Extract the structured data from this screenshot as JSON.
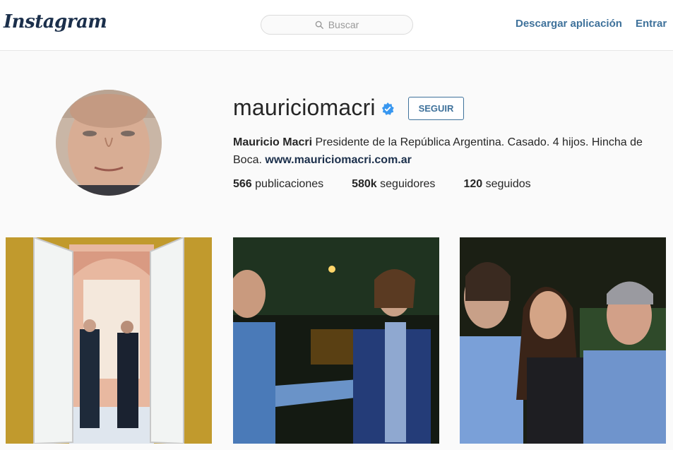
{
  "header": {
    "logo": "Instagram",
    "search_placeholder": "Buscar",
    "download_label": "Descargar aplicación",
    "login_label": "Entrar"
  },
  "profile": {
    "username": "mauriciomacri",
    "follow_label": "SEGUIR",
    "full_name": "Mauricio Macri",
    "bio": "Presidente de la República Argentina. Casado. 4 hijos. Hincha de Boca.",
    "website": "www.mauriciomacri.com.ar",
    "stats": {
      "posts_count": "566",
      "posts_label": "publicaciones",
      "followers_count": "580k",
      "followers_label": "seguidores",
      "following_count": "120",
      "following_label": "seguidos"
    }
  },
  "colors": {
    "link_blue": "#3f729b",
    "verified_blue": "#3897f0",
    "text": "#262626"
  },
  "icons": [
    "search-icon",
    "verified-badge-icon"
  ]
}
